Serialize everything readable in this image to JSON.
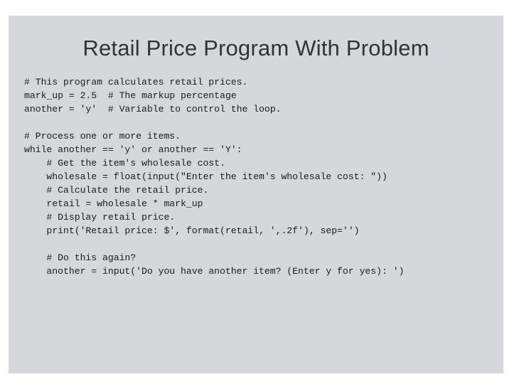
{
  "slide": {
    "title": "Retail Price Program With Problem",
    "background_color": "#ffffff",
    "panel_color": "#d5d7da",
    "title_color": "#333333",
    "code_color": "#1a1a1a",
    "code": {
      "language": "python",
      "lines": [
        "# This program calculates retail prices.",
        "mark_up = 2.5  # The markup percentage",
        "another = 'y'  # Variable to control the loop.",
        "",
        "# Process one or more items.",
        "while another == 'y' or another == 'Y':",
        "    # Get the item's wholesale cost.",
        "    wholesale = float(input(\"Enter the item's wholesale cost: \"))",
        "    # Calculate the retail price.",
        "    retail = wholesale * mark_up",
        "    # Display retail price.",
        "    print('Retail price: $', format(retail, ',.2f'), sep='')",
        "",
        "    # Do this again?",
        "    another = input('Do you have another item? (Enter y for yes): ')"
      ]
    }
  }
}
